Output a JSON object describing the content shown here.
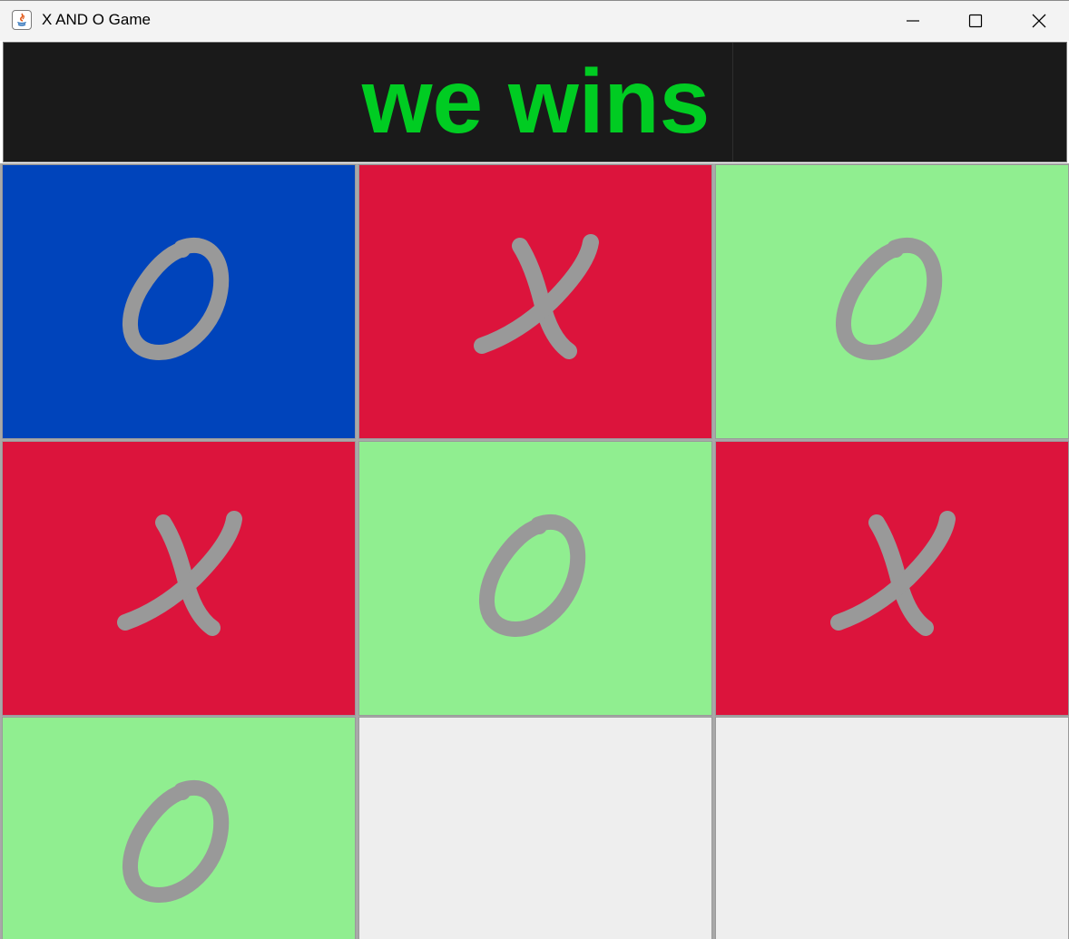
{
  "window": {
    "title": "X AND O Game"
  },
  "status": {
    "message": "we wins",
    "color": "#00cc22"
  },
  "board": {
    "mark_color": "#999999",
    "cells": [
      {
        "mark": "O",
        "color": "#0044bb"
      },
      {
        "mark": "X",
        "color": "#dc143c"
      },
      {
        "mark": "O",
        "color": "#90ee90"
      },
      {
        "mark": "X",
        "color": "#dc143c"
      },
      {
        "mark": "O",
        "color": "#90ee90"
      },
      {
        "mark": "X",
        "color": "#dc143c"
      },
      {
        "mark": "O",
        "color": "#90ee90"
      },
      {
        "mark": "",
        "color": "#eeeeee"
      },
      {
        "mark": "",
        "color": "#eeeeee"
      }
    ]
  }
}
